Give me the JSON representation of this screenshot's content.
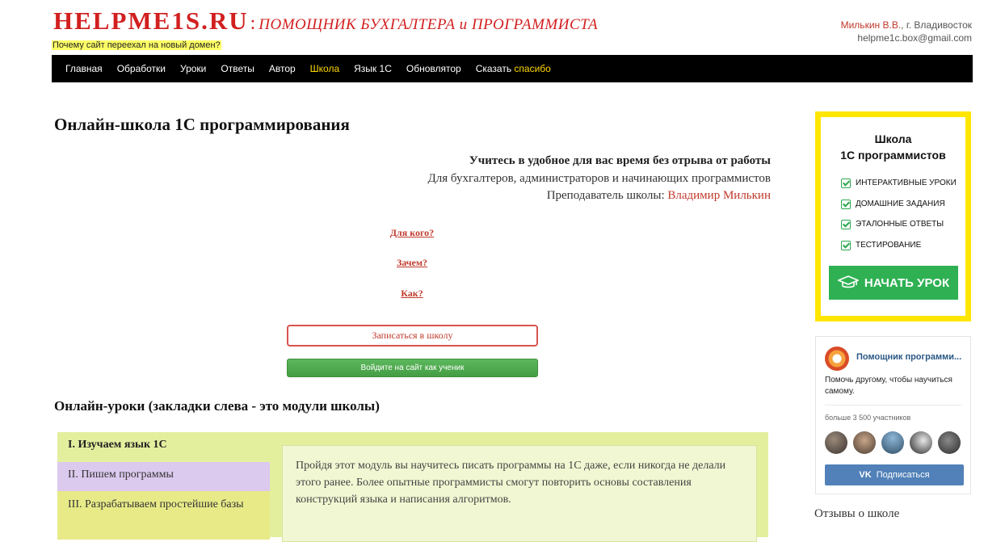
{
  "header": {
    "logo_main": "HELPME1S.RU",
    "logo_colon": ":",
    "logo_slogan": "ПОМОЩНИК БУХГАЛТЕРА и ПРОГРАММИСТА",
    "moved_link": "Почему сайт переехал на новый домен?",
    "author_name": "Милькин В.В.",
    "author_city": ", г. Владивосток",
    "author_email": "helpme1c.box@gmail.com"
  },
  "nav": {
    "items": [
      "Главная",
      "Обработки",
      "Уроки",
      "Ответы",
      "Автор",
      "Школа",
      "Язык 1С",
      "Обновлятор"
    ],
    "thanks_prefix": "Сказать",
    "thanks_word": "спасибо"
  },
  "main": {
    "title": "Онлайн-школа 1С программирования",
    "intro_bold": "Учитесь в удобное для вас время без отрыва от работы",
    "intro_line2": "Для бухгалтеров, администраторов и начинающих программистов",
    "teacher_label": "Преподаватель школы:",
    "teacher_name": "Владимир Милькин",
    "q_for_whom": "Для кого?",
    "q_why": "Зачем?",
    "q_how": "Как?",
    "signup_button": "Записаться в школу",
    "login_button": "Войдите на сайт как ученик",
    "lessons_title": "Онлайн-уроки (закладки слева - это модули школы)",
    "modules": {
      "tab1": "I. Изучаем язык 1С",
      "tab2": "II. Пишем программы",
      "tab3": "III. Разрабатываем простейшие базы",
      "text": "Пройдя этот модуль вы научитесь писать программы на 1С даже, если никогда не делали этого ранее. Более опытные программисты смогут повторить основы составления конструкций языка и написания алгоритмов."
    }
  },
  "sidebar": {
    "school_title_1": "Школа",
    "school_title_2": "1С программистов",
    "features": [
      "Интерактивные уроки",
      "Домашние задания",
      "Эталонные ответы",
      "Тестирование"
    ],
    "start_button": "Начать урок",
    "vk": {
      "group_name": "Помощник программи...",
      "description": "Помочь другому, чтобы научиться самому.",
      "members": "больше 3 500 участников",
      "subscribe": "Подписаться",
      "vk_logo": "VK"
    },
    "reviews_title": "Отзывы о школе"
  },
  "colors": {
    "brand_red": "#d21f1f",
    "nav_bg": "#000000",
    "nav_highlight": "#ffd800",
    "school_border": "#ffe600",
    "green": "#2fb153",
    "vk_blue": "#5181b8"
  }
}
